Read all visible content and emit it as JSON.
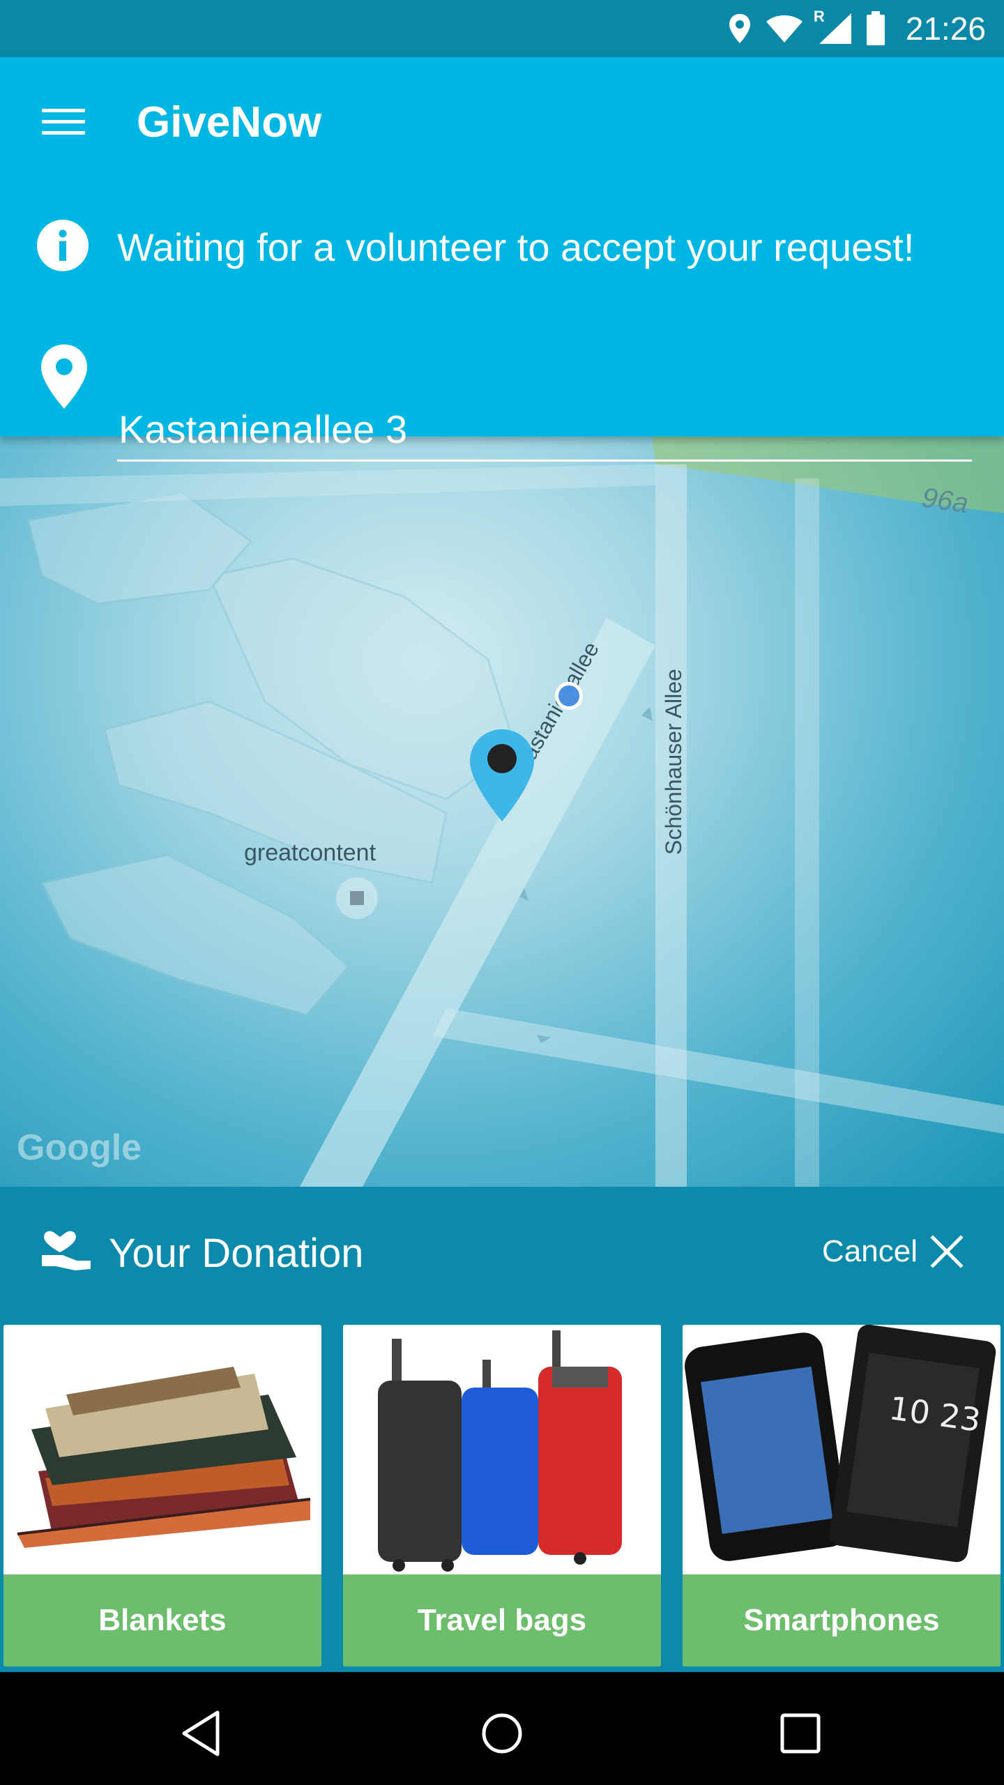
{
  "status_bar": {
    "time": "21:26",
    "icons": [
      "location-icon",
      "wifi-icon",
      "signal-icon",
      "battery-icon"
    ],
    "signal_roaming": "R"
  },
  "header": {
    "title": "GiveNow",
    "info_message": "Waiting for a volunteer to accept your request!",
    "address_value": "Kastanienallee 3",
    "background_color": "#00b7e3"
  },
  "map": {
    "labels": {
      "greatcontent": "greatcontent",
      "kastanienallee": "Kastanienallee",
      "schoenhauser": "Schönhauser Allee",
      "house_number": "96a"
    },
    "attribution": "Google"
  },
  "donation": {
    "title": "Your Donation",
    "cancel_label": "Cancel",
    "items": [
      {
        "label": "Blankets",
        "icon": "blankets-image"
      },
      {
        "label": "Travel bags",
        "icon": "travel-bags-image"
      },
      {
        "label": "Smartphones",
        "icon": "smartphones-image"
      }
    ],
    "label_color": "#6cbd6c"
  },
  "nav_bar": {
    "buttons": [
      "back-icon",
      "home-icon",
      "recents-icon"
    ]
  }
}
